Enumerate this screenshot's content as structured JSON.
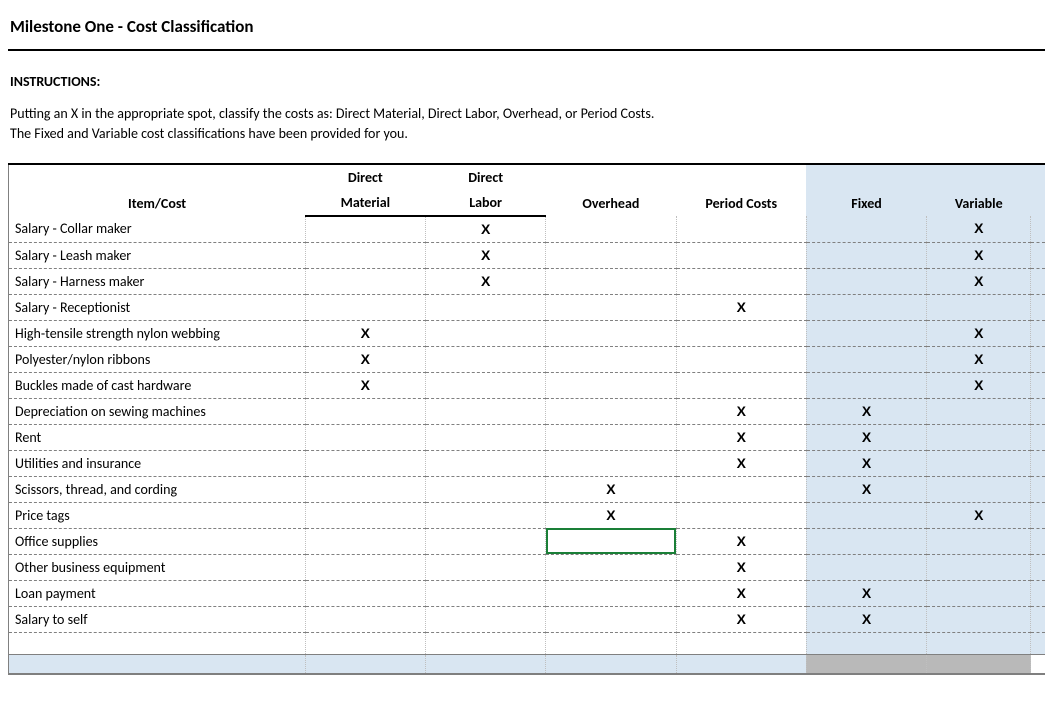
{
  "title": "Milestone One - Cost Classification",
  "instructions_label": "INSTRUCTIONS:",
  "instructions_line1": "Putting an X in the appropriate spot, classify the costs as:  Direct Material, Direct Labor, Overhead, or Period Costs.",
  "instructions_line2": "The Fixed and Variable cost classifications have been provided for you.",
  "mark": "X",
  "headers": {
    "item": "Item/Cost",
    "direct_material_top": "Direct",
    "direct_material_bot": "Material",
    "direct_labor_top": "Direct",
    "direct_labor_bot": "Labor",
    "overhead": "Overhead",
    "period_costs": "Period Costs",
    "fixed": "Fixed",
    "variable": "Variable"
  },
  "chart_data": {
    "type": "table",
    "columns": [
      "Item/Cost",
      "Direct Material",
      "Direct Labor",
      "Overhead",
      "Period Costs",
      "Fixed",
      "Variable"
    ],
    "rows": [
      {
        "item": "Salary - Collar maker",
        "dm": false,
        "dl": true,
        "oh": false,
        "pc": false,
        "fx": false,
        "vr": true
      },
      {
        "item": "Salary - Leash maker",
        "dm": false,
        "dl": true,
        "oh": false,
        "pc": false,
        "fx": false,
        "vr": true
      },
      {
        "item": "Salary - Harness maker",
        "dm": false,
        "dl": true,
        "oh": false,
        "pc": false,
        "fx": false,
        "vr": true
      },
      {
        "item": "Salary - Receptionist",
        "dm": false,
        "dl": false,
        "oh": false,
        "pc": true,
        "fx": false,
        "vr": false
      },
      {
        "item": "High-tensile strength nylon webbing",
        "dm": true,
        "dl": false,
        "oh": false,
        "pc": false,
        "fx": false,
        "vr": true
      },
      {
        "item": "Polyester/nylon ribbons",
        "dm": true,
        "dl": false,
        "oh": false,
        "pc": false,
        "fx": false,
        "vr": true
      },
      {
        "item": "Buckles made of cast hardware",
        "dm": true,
        "dl": false,
        "oh": false,
        "pc": false,
        "fx": false,
        "vr": true
      },
      {
        "item": "Depreciation on sewing machines",
        "dm": false,
        "dl": false,
        "oh": false,
        "pc": true,
        "fx": true,
        "vr": false
      },
      {
        "item": "Rent",
        "dm": false,
        "dl": false,
        "oh": false,
        "pc": true,
        "fx": true,
        "vr": false
      },
      {
        "item": "Utilities and insurance",
        "dm": false,
        "dl": false,
        "oh": false,
        "pc": true,
        "fx": true,
        "vr": false
      },
      {
        "item": "Scissors, thread, and cording",
        "dm": false,
        "dl": false,
        "oh": true,
        "pc": false,
        "fx": true,
        "vr": false
      },
      {
        "item": "Price tags",
        "dm": false,
        "dl": false,
        "oh": true,
        "pc": false,
        "fx": false,
        "vr": true
      },
      {
        "item": "Office supplies",
        "dm": false,
        "dl": false,
        "oh": false,
        "pc": true,
        "fx": false,
        "vr": false
      },
      {
        "item": "Other business equipment",
        "dm": false,
        "dl": false,
        "oh": false,
        "pc": true,
        "fx": false,
        "vr": false
      },
      {
        "item": "Loan payment",
        "dm": false,
        "dl": false,
        "oh": false,
        "pc": true,
        "fx": true,
        "vr": false
      },
      {
        "item": "Salary to self",
        "dm": false,
        "dl": false,
        "oh": false,
        "pc": true,
        "fx": true,
        "vr": false
      }
    ],
    "selected_cell": {
      "row_index": 12,
      "col": "oh"
    }
  }
}
